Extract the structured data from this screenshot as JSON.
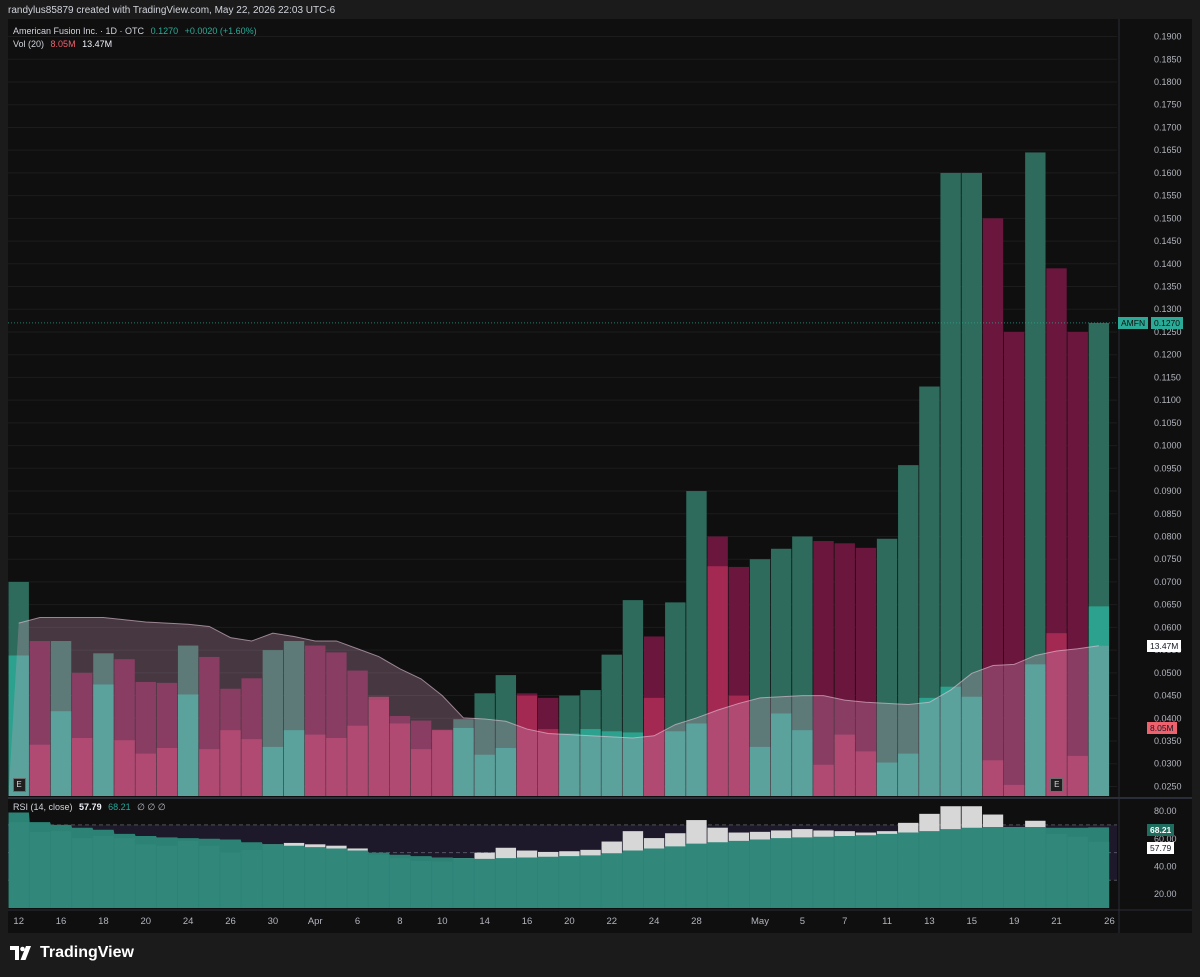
{
  "credit": "randylus85879 created with TradingView.com, May 22, 2026 22:03 UTC-6",
  "legend": {
    "symbol": "American Fusion Inc. · 1D · OTC",
    "last": "0.1270",
    "change": "+0.0020 (+1.60%)",
    "vol_label": "Vol (20)",
    "vol_value": "8.05M",
    "vol_ma": "13.47M",
    "rsi_label": "RSI (14, close)",
    "rsi_value": "57.79",
    "rsi_ma": "68.21",
    "rsi_extra": "∅ ∅ ∅"
  },
  "price_labels": {
    "ticker": "AMFN",
    "price": "0.1270",
    "vol_ma": "13.47M",
    "vol": "8.05M",
    "rsi_ma": "68.21",
    "rsi": "57.79"
  },
  "earnings_badge": "E",
  "brand": "TradingView",
  "colors": {
    "up": "#2e6b5c",
    "down": "#6b173d",
    "vol_up": "#2bab97",
    "vol_down": "#ad2d57",
    "vol_ma_fill": "#d9a3c4",
    "rsi_fill": "#2c8577",
    "rsi_bar": "#d7d7d7",
    "accent_label": "#2bab97",
    "neg_label": "#f0616e"
  },
  "chart_data": [
    {
      "type": "bar",
      "title": "American Fusion Inc. · 1D · OTC",
      "series_kind": "daily close (bar height) with up/down coloring",
      "y_ticks": [
        "0.1900",
        "0.1850",
        "0.1800",
        "0.1750",
        "0.1700",
        "0.1650",
        "0.1600",
        "0.1550",
        "0.1500",
        "0.1450",
        "0.1400",
        "0.1350",
        "0.1300",
        "0.1250",
        "0.1200",
        "0.1150",
        "0.1100",
        "0.1050",
        "0.1000",
        "0.0950",
        "0.0900",
        "0.0850",
        "0.0800",
        "0.0750",
        "0.0700",
        "0.0650",
        "0.0600",
        "0.0550",
        "0.0500",
        "0.0450",
        "0.0400",
        "0.0350",
        "0.0300",
        "0.0250"
      ],
      "ylim": [
        0.0229,
        0.1921
      ],
      "x_ticks": [
        "12",
        "16",
        "18",
        "20",
        "24",
        "26",
        "30",
        "Apr",
        "6",
        "8",
        "10",
        "14",
        "16",
        "20",
        "22",
        "24",
        "28",
        "May",
        "5",
        "7",
        "11",
        "13",
        "15",
        "19",
        "21",
        "26"
      ],
      "x_tick_bar_index": [
        0,
        2,
        4,
        6,
        8,
        10,
        12,
        14,
        16,
        18,
        20,
        22,
        24,
        26,
        28,
        30,
        32,
        35,
        37,
        39,
        41,
        43,
        45,
        47,
        49,
        51.5
      ],
      "close": [
        0.07,
        0.057,
        0.057,
        0.05,
        0.0543,
        0.053,
        0.048,
        0.0478,
        0.056,
        0.0535,
        0.0465,
        0.0488,
        0.055,
        0.057,
        0.056,
        0.0545,
        0.0505,
        0.044,
        0.0405,
        0.0395,
        0.0375,
        0.0398,
        0.0455,
        0.0495,
        0.0455,
        0.0445,
        0.045,
        0.0462,
        0.054,
        0.066,
        0.058,
        0.0655,
        0.09,
        0.08,
        0.0733,
        0.075,
        0.0773,
        0.08,
        0.079,
        0.0785,
        0.0775,
        0.0795,
        0.0957,
        0.113,
        0.16,
        0.16,
        0.15,
        0.125,
        0.1645,
        0.139,
        0.125,
        0.127
      ],
      "direction": [
        "up",
        "down",
        "up",
        "down",
        "up",
        "down",
        "down",
        "down",
        "up",
        "down",
        "down",
        "down",
        "up",
        "up",
        "down",
        "down",
        "down",
        "down",
        "down",
        "down",
        "down",
        "up",
        "up",
        "up",
        "down",
        "down",
        "up",
        "up",
        "up",
        "up",
        "down",
        "up",
        "up",
        "down",
        "down",
        "up",
        "up",
        "up",
        "down",
        "down",
        "down",
        "up",
        "up",
        "up",
        "up",
        "up",
        "down",
        "down",
        "up",
        "down",
        "down",
        "up"
      ],
      "earnings_marker_bar_index": [
        0,
        49
      ]
    },
    {
      "type": "bar",
      "title": "Vol (20)",
      "values_M": [
        12.6,
        4.6,
        7.6,
        5.2,
        10.0,
        5.0,
        3.8,
        4.3,
        9.1,
        4.2,
        5.9,
        5.1,
        4.4,
        5.9,
        5.5,
        5.2,
        6.3,
        8.9,
        6.5,
        4.2,
        5.9,
        6.1,
        3.7,
        4.3,
        9.0,
        6.0,
        5.6,
        6.0,
        5.8,
        5.7,
        8.8,
        5.8,
        6.5,
        20.6,
        9.0,
        4.4,
        7.4,
        5.9,
        2.8,
        5.5,
        4.0,
        3.0,
        3.8,
        8.8,
        9.8,
        8.9,
        3.2,
        1.0,
        11.8,
        14.6,
        3.6,
        17.0
      ],
      "ma_M": [
        15.5,
        16.0,
        16.0,
        16.0,
        16.0,
        15.8,
        15.6,
        15.5,
        15.4,
        15.2,
        14.2,
        13.9,
        14.6,
        14.3,
        13.9,
        13.9,
        13.2,
        12.5,
        11.4,
        10.5,
        9.0,
        7.0,
        6.9,
        6.7,
        6.0,
        5.6,
        5.5,
        5.4,
        5.3,
        5.2,
        5.4,
        6.4,
        7.0,
        7.7,
        8.3,
        8.8,
        8.9,
        9.0,
        9.0,
        8.6,
        8.4,
        8.3,
        8.2,
        8.4,
        9.5,
        11.0,
        11.7,
        11.8,
        12.6,
        13.0,
        13.2,
        13.47
      ],
      "last_value": "8.05M",
      "last_ma": "13.47M"
    },
    {
      "type": "area",
      "title": "RSI (14, close)",
      "ylim": [
        10,
        88
      ],
      "y_ticks": [
        80,
        60,
        40,
        20
      ],
      "bands": [
        30,
        50,
        70
      ],
      "rsi": [
        72.0,
        65.0,
        65.5,
        60.5,
        62.0,
        60.5,
        56.0,
        55.0,
        58.5,
        55.0,
        50.0,
        52.0,
        56.0,
        57.0,
        56.0,
        55.0,
        53.0,
        48.5,
        46.0,
        44.0,
        43.5,
        46.0,
        50.0,
        53.5,
        51.5,
        50.5,
        51.0,
        52.0,
        58.0,
        65.5,
        60.5,
        64.0,
        73.5,
        68.0,
        64.5,
        65.0,
        66.0,
        67.0,
        66.0,
        65.5,
        64.5,
        65.5,
        71.5,
        78.0,
        83.5,
        83.5,
        77.5,
        68.5,
        73.0,
        63.5,
        61.5,
        57.79
      ],
      "rsi_ma": [
        79.0,
        72.0,
        70.0,
        68.0,
        66.5,
        63.5,
        62.0,
        61.0,
        60.5,
        60.0,
        59.5,
        57.5,
        56.0,
        55.0,
        54.0,
        53.0,
        51.5,
        50.0,
        48.5,
        47.5,
        46.5,
        46.0,
        45.5,
        46.0,
        46.5,
        47.0,
        47.5,
        48.0,
        49.5,
        51.5,
        53.0,
        54.5,
        56.5,
        57.5,
        58.5,
        59.5,
        60.5,
        61.0,
        61.5,
        62.0,
        62.5,
        63.5,
        64.5,
        65.5,
        67.0,
        68.0,
        68.5,
        68.5,
        68.5,
        68.0,
        68.0,
        68.21
      ],
      "last_value": "57.79",
      "last_ma": "68.21"
    }
  ]
}
